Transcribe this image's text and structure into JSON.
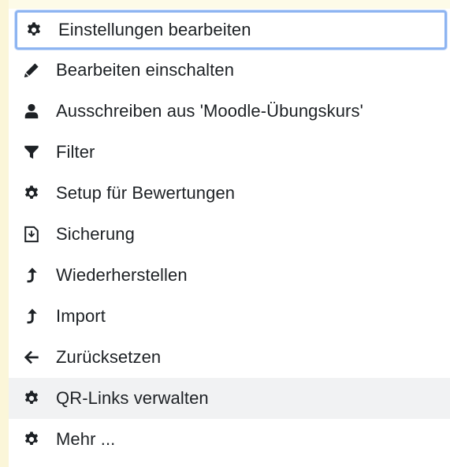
{
  "menu": {
    "items": [
      {
        "label": "Einstellungen bearbeiten",
        "icon": "gear-icon"
      },
      {
        "label": "Bearbeiten einschalten",
        "icon": "pencil-icon"
      },
      {
        "label": "Ausschreiben aus 'Moodle-Übungskurs'",
        "icon": "user-icon"
      },
      {
        "label": "Filter",
        "icon": "filter-icon"
      },
      {
        "label": "Setup für Bewertungen",
        "icon": "gear-icon"
      },
      {
        "label": "Sicherung",
        "icon": "file-icon"
      },
      {
        "label": "Wiederherstellen",
        "icon": "level-up-icon"
      },
      {
        "label": "Import",
        "icon": "level-up-icon"
      },
      {
        "label": "Zurücksetzen",
        "icon": "arrow-left-icon"
      },
      {
        "label": "QR-Links verwalten",
        "icon": "gear-icon"
      },
      {
        "label": "Mehr ...",
        "icon": "gear-icon"
      }
    ]
  }
}
